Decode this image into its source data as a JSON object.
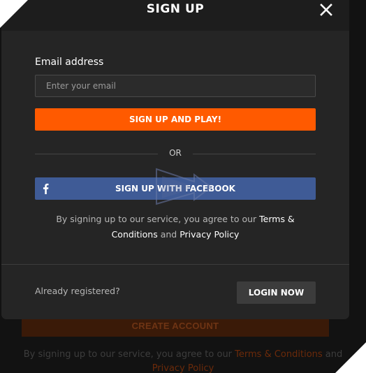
{
  "modal": {
    "title": "SIGN UP",
    "close_icon": "close-icon",
    "email": {
      "label": "Email address",
      "placeholder": "Enter your email",
      "value": ""
    },
    "signup_button": "SIGN UP AND PLAY!",
    "divider_text": "OR",
    "facebook_button": {
      "label": "SIGN UP WITH FACEBOOK",
      "icon": "facebook-icon"
    },
    "terms": {
      "prefix": "By signing up to our service, you agree to our ",
      "terms_link": "Terms & Conditions",
      "middle": " and ",
      "privacy_link": "Privacy Policy"
    },
    "footer": {
      "already_text": "Already registered?",
      "login_button": "LOGIN NOW"
    }
  },
  "background": {
    "create_account_button": "CREATE ACCOUNT",
    "terms_prefix": "By signing up to our service, you agree to our ",
    "terms_link": "Terms & Conditions",
    "terms_middle": " and",
    "privacy_link": "Privacy Policy"
  },
  "colors": {
    "accent": "#ff5a00",
    "facebook": "#3f5b96",
    "modal_bg": "#252525",
    "header_bg": "#1d1d1d"
  }
}
